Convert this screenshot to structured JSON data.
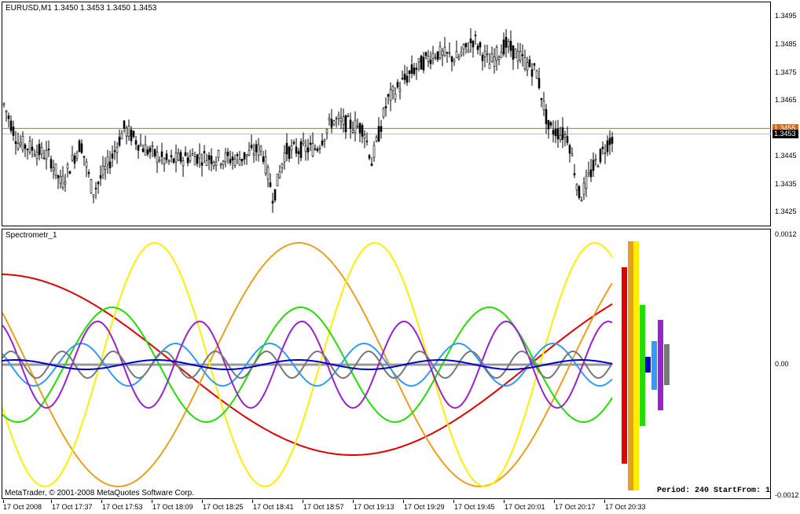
{
  "main_chart": {
    "title": "EURUSD,M1  1.3450 1.3453 1.3450 1.3453",
    "price_labels": [
      "1.3495",
      "1.3485",
      "1.3475",
      "1.3465",
      "1.3455",
      "1.3445",
      "1.3435",
      "1.3425"
    ],
    "current_price": "1.3453",
    "level_price": "1.3455",
    "level_color": "#d2691e",
    "current_line_color": "#c0c0c0"
  },
  "indicator": {
    "title": "Spectrometr_1",
    "scale_labels": [
      "0.0012",
      "0.00",
      "-0.0012"
    ],
    "period_label": "Period: 240 StartFrom: 1",
    "colors": {
      "red": "#e00000",
      "orange": "#e8a020",
      "yellow": "#ffee00",
      "green": "#22dd00",
      "teal": "#3399ff",
      "purple": "#9922cc",
      "blue": "#0000cc",
      "gray": "#777777"
    }
  },
  "time_axis": {
    "labels": [
      "17 Oct 2008",
      "17 Oct 17:37",
      "17 Oct 17:53",
      "17 Oct 18:09",
      "17 Oct 18:25",
      "17 Oct 18:41",
      "17 Oct 18:57",
      "17 Oct 19:13",
      "17 Oct 19:29",
      "17 Oct 19:45",
      "17 Oct 20:01",
      "17 Oct 20:17",
      "17 Oct 20:33"
    ]
  },
  "footer": {
    "copyright": "MetaTrader, © 2001-2008 MetaQuotes Software Corp."
  }
}
